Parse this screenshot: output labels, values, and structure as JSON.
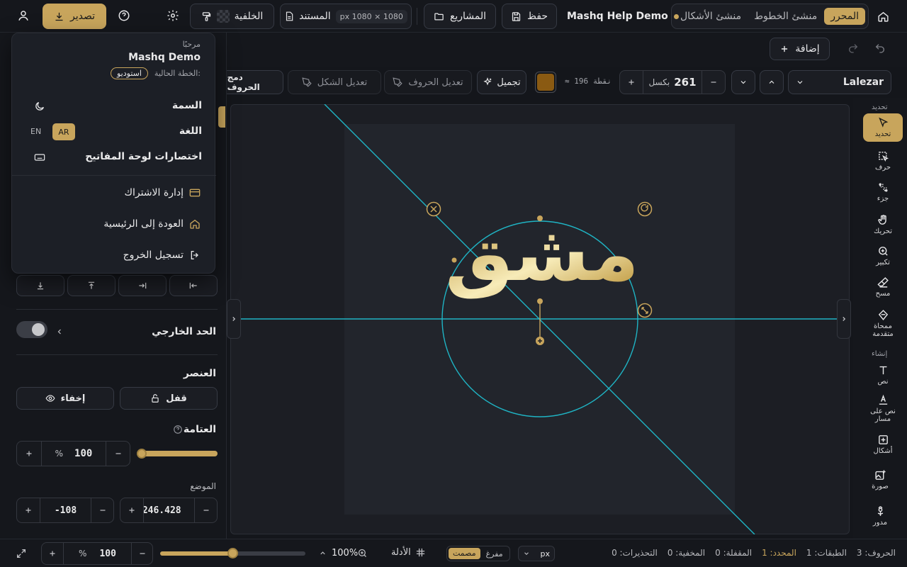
{
  "topbar": {
    "home_tab": "المحرر",
    "tab_fonts": "منشئ الخطوط",
    "tab_shapes": "منشئ الأشكال",
    "project_name": "Mashq Help Demo",
    "save": "حفظ",
    "projects": "المشاريع",
    "document": "المستند",
    "document_size": "1080 × 1080 px",
    "background": "الخلفية",
    "export": "تصدير"
  },
  "toolbar2": {
    "add": "إضافة"
  },
  "fontbar": {
    "font_name": "Lalezar",
    "size_value": "261",
    "size_unit": "بكسل",
    "points": "≈ 196 نقطة",
    "color": "#8a5a12",
    "beautify": "تجميل",
    "edit_letters": "تعديل الحروف",
    "edit_shape": "تعديل الشكل",
    "merge_letters": "دمج الحروف"
  },
  "menu": {
    "greeting": "مرحبًا",
    "user_name": "Mashq Demo",
    "plan_label": "الخطة الحالية:",
    "plan_badge": "استوديو",
    "theme": "السمة",
    "language": "اللغة",
    "lang_ar": "AR",
    "lang_en": "EN",
    "shortcuts": "اختصارات لوحة المفاتيح",
    "subscription": "إدارة الاشتراك",
    "back_home": "العودة إلى الرئيسية",
    "logout": "تسجيل الخروج"
  },
  "leftpanel": {
    "outline": "الحد الخارجي",
    "element": "العنصر",
    "lock": "قفل",
    "hide": "إخفاء",
    "opacity": "العتامة",
    "opacity_value": "100",
    "opacity_unit": "%",
    "opacity_level": 0.0,
    "position": "الموضع",
    "pos_x": "-246.428",
    "pos_y": "-108"
  },
  "rail": {
    "section_select": "تحديد",
    "select": "تحديد",
    "letter": "حرف",
    "part": "جزء",
    "move": "تحريك",
    "zoom": "تكبير",
    "erase": "مسح",
    "advanced_eraser": "ممحاة متقدمة",
    "section_create": "إنشاء",
    "text": "نص",
    "text_on_path": "نص على مسار",
    "shapes": "أشكال",
    "image": "صورة",
    "rotated": "مدور"
  },
  "canvas": {
    "artwork_text": "مشق",
    "artwork_color_light": "#f7ebb8",
    "artwork_color_dark": "#b58a2a",
    "guide_color": "#1fb4c4"
  },
  "statusbar": {
    "zoom_value": "100",
    "zoom_unit": "%",
    "zoom_label": "100%",
    "guides": "الأدلة",
    "mode_flat": "مفرغ",
    "mode_solid": "مصمت",
    "unit": "px",
    "warnings": "التحذيرات: 0",
    "hidden": "المخفية: 0",
    "locked": "المقفلة: 0",
    "selected": "المحدد: 1",
    "layers": "الطبقات: 1",
    "letters": "الحروف: 3",
    "zoom_level": 0.5
  }
}
